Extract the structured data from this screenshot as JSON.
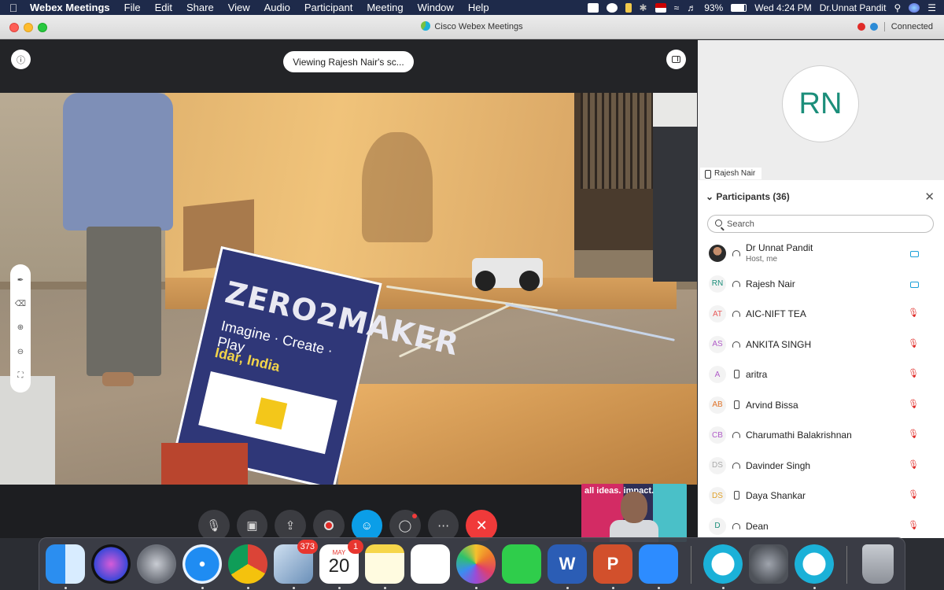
{
  "menubar": {
    "app": "Webex Meetings",
    "menus": [
      "File",
      "Edit",
      "Share",
      "View",
      "Audio",
      "Participant",
      "Meeting",
      "Window",
      "Help"
    ],
    "battery": "93%",
    "clock": "Wed 4:24 PM",
    "user": "Dr.Unnat Pandit"
  },
  "window": {
    "title": "Cisco Webex Meetings",
    "status": "Connected"
  },
  "stage": {
    "viewing_label": "Viewing Rajesh Nair's sc...",
    "sign_title": "ZERO2MAKER",
    "sign_tagline": "Imagine · Create · Play",
    "sign_location": "Idar, India",
    "selfview_text": "all ideas. impact."
  },
  "controls": {
    "items": [
      "mute",
      "video",
      "share",
      "record",
      "participants",
      "chat",
      "more",
      "leave"
    ]
  },
  "active_speaker": {
    "initials": "RN",
    "name": "Rajesh Nair"
  },
  "participants": {
    "title": "Participants (36)",
    "search_placeholder": "Search",
    "list": [
      {
        "initials": "",
        "name": "Dr Unnat Pandit",
        "sub": "Host, me",
        "device": "audio",
        "status": "video",
        "color": ""
      },
      {
        "initials": "RN",
        "name": "Rajesh Nair",
        "sub": "",
        "device": "audio",
        "status": "video",
        "color": "#1b8e7a"
      },
      {
        "initials": "AT",
        "name": "AIC-NIFT TEA",
        "sub": "",
        "device": "audio",
        "status": "muted",
        "color": "#e85b5b"
      },
      {
        "initials": "AS",
        "name": "ANKITA SINGH",
        "sub": "",
        "device": "audio",
        "status": "muted",
        "color": "#b05cc8"
      },
      {
        "initials": "A",
        "name": "aritra",
        "sub": "",
        "device": "phone",
        "status": "muted",
        "color": "#b05cc8"
      },
      {
        "initials": "AB",
        "name": "Arvind Bissa",
        "sub": "",
        "device": "phone",
        "status": "muted",
        "color": "#e0742a"
      },
      {
        "initials": "CB",
        "name": "Charumathi Balakrishnan",
        "sub": "",
        "device": "audio",
        "status": "muted",
        "color": "#b05cc8"
      },
      {
        "initials": "DS",
        "name": "Davinder Singh",
        "sub": "",
        "device": "audio",
        "status": "muted",
        "color": "#aaaaaa"
      },
      {
        "initials": "DS",
        "name": "Daya Shankar",
        "sub": "",
        "device": "phone",
        "status": "muted",
        "color": "#e0a12a"
      },
      {
        "initials": "D",
        "name": "Dean",
        "sub": "",
        "device": "audio",
        "status": "muted",
        "color": "#1b8e7a"
      }
    ]
  },
  "dock": {
    "mail_badge": "373",
    "calendar_month": "MAY",
    "calendar_day": "20",
    "calendar_badge": "1",
    "word_letter": "W",
    "powerpoint_letter": "P"
  }
}
